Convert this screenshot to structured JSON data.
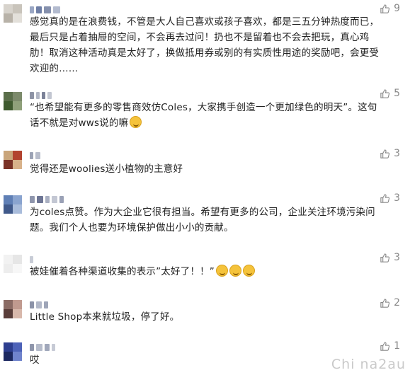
{
  "comments": [
    {
      "likes": "9",
      "lines": [
        "感觉真的是在浪费钱，不管是大人自己喜欢或孩子喜欢，都是三五分钟热度而已，",
        "最后只是占着抽屉的空间，不会再去过问！扔也不是留着也不会去把玩，真心鸡",
        "肋！取消这种活动真是太好了，换做抵用券或别的有实质性用途的奖励吧，会更受",
        "欢迎的……"
      ]
    },
    {
      "likes": "5",
      "lines": [
        "“也希望能有更多的零售商效仿Coles，大家携手创造一个更加绿色的明天”。这句",
        "话不就是对wws说的嘛"
      ]
    },
    {
      "likes": "3",
      "lines": [
        "觉得还是woolies送小植物的主意好"
      ]
    },
    {
      "likes": "3",
      "lines": [
        "为coles点赞。作为大企业它很有担当。希望有更多的公司，企业关注环境污染问",
        "题。我们个人也要为环境保护做出小小的贡献。"
      ]
    },
    {
      "likes": "3",
      "lines": [
        "被娃催着各种渠道收集的表示”太好了！！”"
      ]
    },
    {
      "likes": "2",
      "lines": [
        "Little Shop本来就垃圾，停了好。"
      ]
    },
    {
      "likes": "1",
      "lines": [
        "哎"
      ]
    }
  ],
  "watermark": "Chi na2au",
  "colors": {
    "like_gray": "#888888",
    "text": "#222222",
    "emoji": "#f5c33b"
  },
  "icons": {
    "like": "thumbs-up-icon",
    "emoji": "laughing-emoji-icon"
  }
}
